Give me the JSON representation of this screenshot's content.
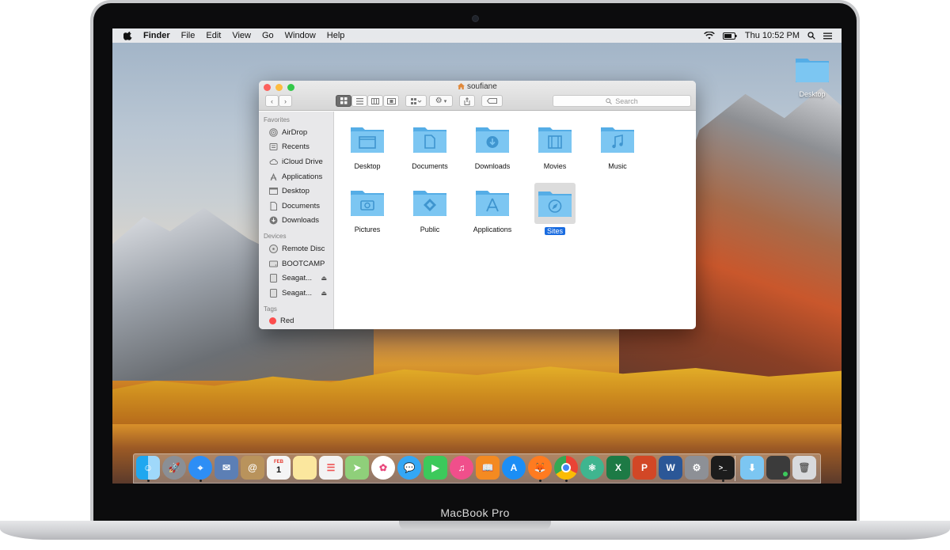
{
  "laptop": {
    "model_label": "MacBook Pro"
  },
  "menubar": {
    "app_name": "Finder",
    "menus": [
      "File",
      "Edit",
      "View",
      "Go",
      "Window",
      "Help"
    ],
    "clock": "Thu 10:52 PM"
  },
  "desktop": {
    "icon_label": "Desktop"
  },
  "window": {
    "title": "soufiane",
    "search_placeholder": "Search"
  },
  "sidebar": {
    "favorites_header": "Favorites",
    "favorites": [
      "AirDrop",
      "Recents",
      "iCloud Drive",
      "Applications",
      "Desktop",
      "Documents",
      "Downloads"
    ],
    "devices_header": "Devices",
    "devices": [
      "Remote Disc",
      "BOOTCAMP",
      "Seagat...",
      "Seagat..."
    ],
    "tags_header": "Tags",
    "tags": [
      "Red"
    ]
  },
  "folders": [
    "Desktop",
    "Documents",
    "Downloads",
    "Movies",
    "Music",
    "Pictures",
    "Public",
    "Applications",
    "Sites"
  ],
  "selected_folder": "Sites",
  "dock": {
    "calendar_month": "FEB",
    "calendar_day": "1"
  },
  "colors": {
    "folder": "#7cc6f2",
    "folder_dark": "#55ade6",
    "selection": "#1a6ce0",
    "close": "#fc615d",
    "minimize": "#fdbc40",
    "zoom": "#34c84a"
  }
}
